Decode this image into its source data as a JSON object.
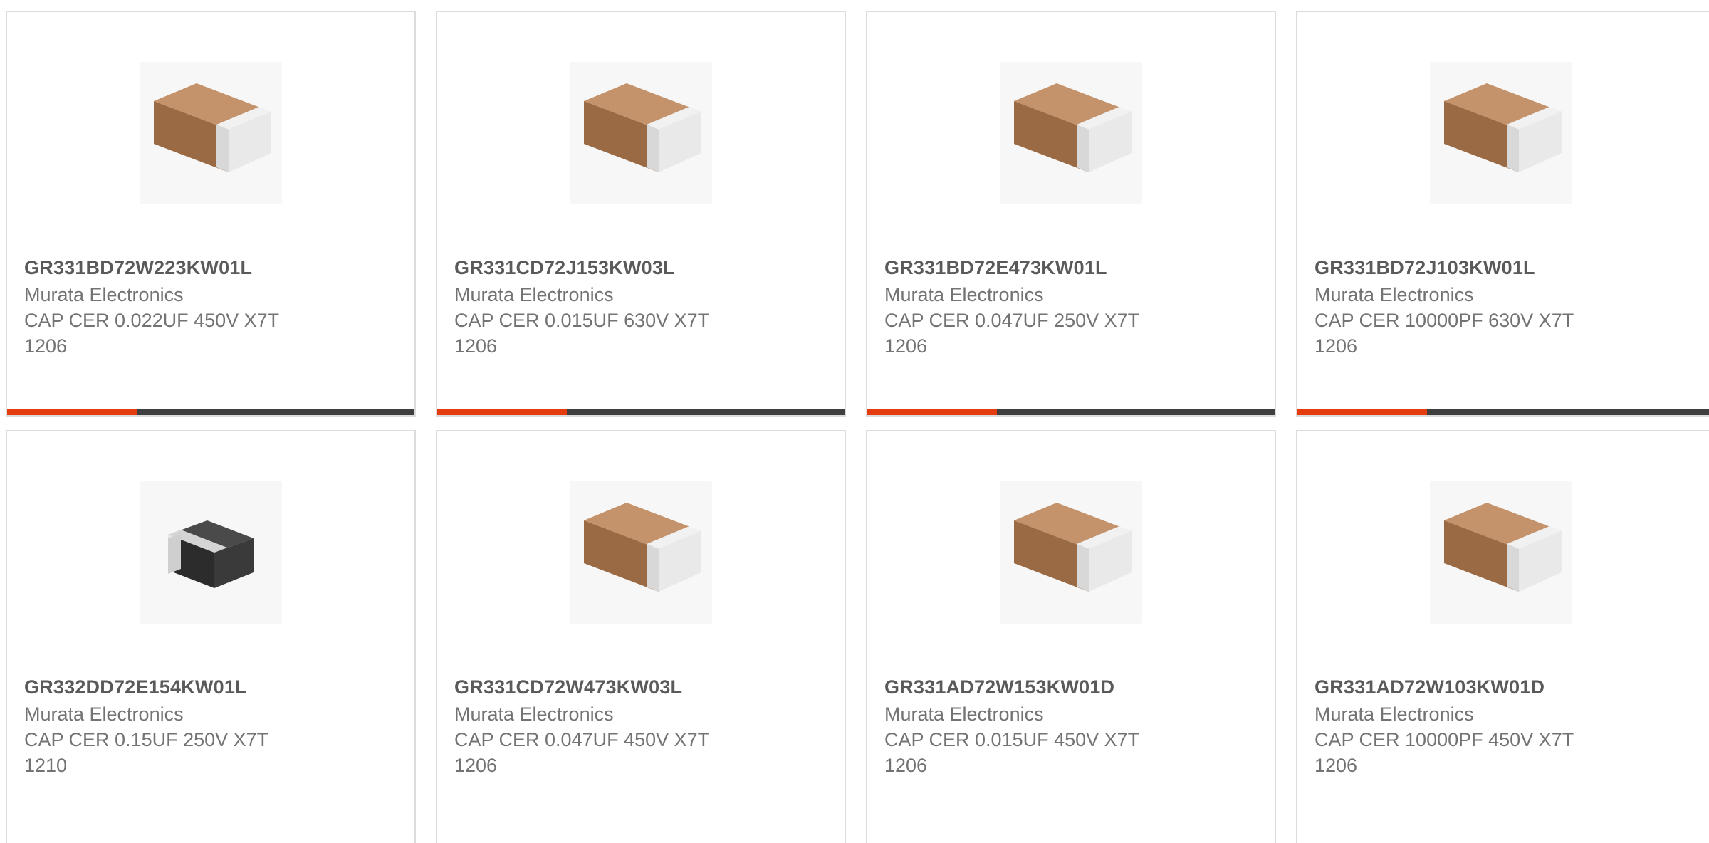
{
  "colors": {
    "accent": "#e63a0f",
    "bar": "#3f3f3f",
    "border": "#dcdcdc",
    "part_text": "#5a5a5a",
    "body_text": "#737373"
  },
  "products": [
    {
      "part_number": "GR331BD72W223KW01L",
      "manufacturer": "Murata Electronics",
      "description_line1": "CAP CER 0.022UF 450V X7T",
      "description_line2": "1206",
      "image_icon": "capacitor-tan-1206-icon"
    },
    {
      "part_number": "GR331CD72J153KW03L",
      "manufacturer": "Murata Electronics",
      "description_line1": "CAP CER 0.015UF 630V X7T",
      "description_line2": "1206",
      "image_icon": "capacitor-tan-1206-icon"
    },
    {
      "part_number": "GR331BD72E473KW01L",
      "manufacturer": "Murata Electronics",
      "description_line1": "CAP CER 0.047UF 250V X7T",
      "description_line2": "1206",
      "image_icon": "capacitor-tan-1206-icon"
    },
    {
      "part_number": "GR331BD72J103KW01L",
      "manufacturer": "Murata Electronics",
      "description_line1": "CAP CER 10000PF 630V X7T",
      "description_line2": "1206",
      "image_icon": "capacitor-tan-1206-icon"
    },
    {
      "part_number": "GR332DD72E154KW01L",
      "manufacturer": "Murata Electronics",
      "description_line1": "CAP CER 0.15UF 250V X7T",
      "description_line2": "1210",
      "image_icon": "capacitor-black-1210-icon"
    },
    {
      "part_number": "GR331CD72W473KW03L",
      "manufacturer": "Murata Electronics",
      "description_line1": "CAP CER 0.047UF 450V X7T",
      "description_line2": "1206",
      "image_icon": "capacitor-tan-1206-icon"
    },
    {
      "part_number": "GR331AD72W153KW01D",
      "manufacturer": "Murata Electronics",
      "description_line1": "CAP CER 0.015UF 450V X7T",
      "description_line2": "1206",
      "image_icon": "capacitor-tan-1206-icon"
    },
    {
      "part_number": "GR331AD72W103KW01D",
      "manufacturer": "Murata Electronics",
      "description_line1": "CAP CER 10000PF 450V X7T",
      "description_line2": "1206",
      "image_icon": "capacitor-tan-1206-icon"
    }
  ]
}
